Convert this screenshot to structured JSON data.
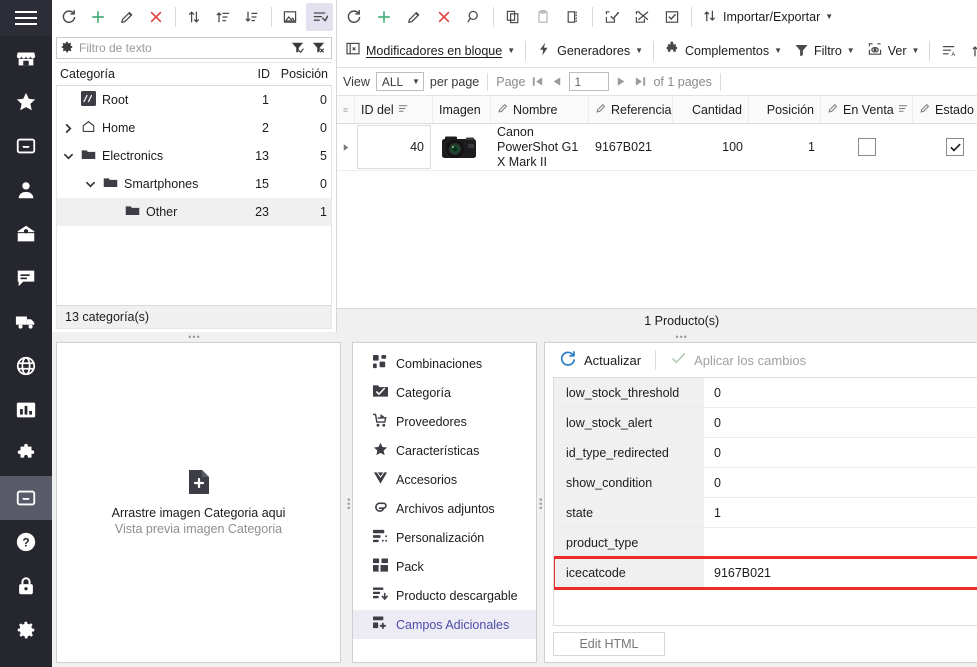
{
  "sidebar": {
    "menu_icon": "hamburger-menu-icon",
    "items": [
      {
        "icon": "store-icon",
        "name": "sidebar-item-store",
        "active": false
      },
      {
        "icon": "star-icon",
        "name": "sidebar-item-favorites",
        "active": false
      },
      {
        "icon": "inbox-icon",
        "name": "sidebar-item-orders",
        "active": false
      },
      {
        "icon": "user-icon",
        "name": "sidebar-item-customers",
        "active": false
      },
      {
        "icon": "envelope-icon",
        "name": "sidebar-item-messages",
        "active": false
      },
      {
        "icon": "chat-icon",
        "name": "sidebar-item-chat",
        "active": false
      },
      {
        "icon": "truck-icon",
        "name": "sidebar-item-shipping",
        "active": false
      },
      {
        "icon": "globe-icon",
        "name": "sidebar-item-localization",
        "active": false
      },
      {
        "icon": "chart-icon",
        "name": "sidebar-item-stats",
        "active": false
      },
      {
        "icon": "puzzle-icon",
        "name": "sidebar-item-modules",
        "active": false
      },
      {
        "icon": "inbox-icon",
        "name": "sidebar-item-catalog",
        "active": true
      },
      {
        "icon": "help-icon",
        "name": "sidebar-item-help",
        "active": false
      },
      {
        "icon": "lock-icon",
        "name": "sidebar-item-security",
        "active": false
      },
      {
        "icon": "gear-icon",
        "name": "sidebar-item-settings",
        "active": false
      }
    ]
  },
  "category_panel": {
    "toolbar": [
      {
        "icon": "refresh-icon",
        "name": "category-refresh-button",
        "selected": false
      },
      {
        "icon": "plus-icon",
        "name": "category-add-button",
        "selected": false
      },
      {
        "icon": "pencil-icon",
        "name": "category-edit-button",
        "selected": false
      },
      {
        "icon": "close-x-icon",
        "name": "category-delete-button",
        "selected": false
      },
      {
        "icon": "sort-updown-icon",
        "name": "category-sort-button",
        "selected": false
      },
      {
        "icon": "sort-asc-icon",
        "name": "category-sort-asc-button",
        "selected": false
      },
      {
        "icon": "sort-desc-icon",
        "name": "category-sort-desc-button",
        "selected": false
      },
      {
        "icon": "image-export-icon",
        "name": "category-image-button",
        "selected": false
      },
      {
        "icon": "filter-list-icon",
        "name": "category-filter-button",
        "selected": true
      }
    ],
    "filter": {
      "gear_icon": "gear-icon",
      "placeholder": "Filtro de texto",
      "value": "",
      "apply_icon": "filter-apply-icon",
      "clear_icon": "filter-clear-icon"
    },
    "columns": [
      "Categoría",
      "ID",
      "Posición"
    ],
    "rows": [
      {
        "label": "Root",
        "id": "1",
        "position": "0",
        "depth": 0,
        "twisty": "none",
        "icon": "root-icon",
        "selected": false
      },
      {
        "label": "Home",
        "id": "2",
        "position": "0",
        "depth": 0,
        "twisty": "collapsed",
        "icon": "home-icon",
        "selected": false
      },
      {
        "label": "Electronics",
        "id": "13",
        "position": "5",
        "depth": 0,
        "twisty": "expanded",
        "icon": "folder-icon",
        "selected": false
      },
      {
        "label": "Smartphones",
        "id": "15",
        "position": "0",
        "depth": 1,
        "twisty": "expanded",
        "icon": "folder-icon",
        "selected": false
      },
      {
        "label": "Other",
        "id": "23",
        "position": "1",
        "depth": 2,
        "twisty": "none",
        "icon": "folder-icon",
        "selected": true
      }
    ],
    "status": "13 categoría(s)"
  },
  "product_panel": {
    "toolbar_icons": [
      {
        "icon": "refresh-icon",
        "name": "product-refresh-button"
      },
      {
        "icon": "plus-icon",
        "name": "product-add-button"
      },
      {
        "icon": "pencil-icon",
        "name": "product-edit-button"
      },
      {
        "icon": "close-x-icon",
        "name": "product-delete-button"
      },
      {
        "icon": "search-icon",
        "name": "product-search-button"
      },
      {
        "icon": "copy-icon",
        "name": "product-copy-button"
      },
      {
        "icon": "paste-icon",
        "name": "product-paste-button"
      },
      {
        "icon": "duplicate-icon",
        "name": "product-duplicate-button"
      },
      {
        "icon": "select-all-icon",
        "name": "product-select-all-button"
      },
      {
        "icon": "deselect-icon",
        "name": "product-deselect-button"
      },
      {
        "icon": "check-select-icon",
        "name": "product-check-select-button"
      }
    ],
    "import_export": {
      "label": "Importar/Exportar",
      "icon": "import-export-icon"
    },
    "menus": [
      {
        "label": "Modificadores en bloque",
        "icon": "bulk-modifier-icon",
        "name": "menu-bulk-modifiers"
      },
      {
        "label": "Generadores",
        "icon": "lightning-icon",
        "name": "menu-generators"
      },
      {
        "label": "Complementos",
        "icon": "puzzle-icon",
        "name": "menu-addons"
      },
      {
        "label": "Filtro",
        "icon": "filter-icon",
        "name": "menu-filter"
      },
      {
        "label": "Ver",
        "icon": "eye-box-icon",
        "name": "menu-view"
      }
    ],
    "menu_trailing_icons": [
      {
        "icon": "sort-alpha-icon",
        "name": "sort-alpha-button"
      },
      {
        "icon": "sort-asc-icon",
        "name": "sort-asc-button"
      },
      {
        "icon": "sort-desc-icon",
        "name": "sort-desc-button"
      }
    ],
    "pager": {
      "view_label": "View",
      "per_page_value": "ALL",
      "per_page_label": "per page",
      "page_label": "Page",
      "page_value": "1",
      "of_pages": "of 1 pages",
      "first_icon": "first-page-icon",
      "prev_icon": "prev-page-icon",
      "next_icon": "next-page-icon",
      "last_icon": "last-page-icon"
    },
    "columns": [
      {
        "label": "ID del",
        "editable": false,
        "menu": true,
        "name": "col-id"
      },
      {
        "label": "Imagen",
        "editable": false,
        "menu": false,
        "name": "col-image"
      },
      {
        "label": "Nombre",
        "editable": true,
        "menu": false,
        "name": "col-name"
      },
      {
        "label": "Referencia",
        "editable": true,
        "menu": false,
        "name": "col-reference"
      },
      {
        "label": "Cantidad",
        "editable": false,
        "menu": false,
        "name": "col-quantity"
      },
      {
        "label": "Posición",
        "editable": false,
        "menu": false,
        "name": "col-position"
      },
      {
        "label": "En Venta",
        "editable": true,
        "menu": true,
        "name": "col-on-sale"
      },
      {
        "label": "Estado",
        "editable": true,
        "menu": false,
        "name": "col-status"
      }
    ],
    "rows": [
      {
        "id": "40",
        "image_alt": "canon-powershot-thumbnail",
        "name": "Canon PowerShot G1 X Mark II",
        "reference": "9167B021",
        "quantity": "100",
        "position": "1",
        "on_sale": false,
        "status": true
      }
    ],
    "status": "1 Producto(s)"
  },
  "image_drop": {
    "icon": "add-file-icon",
    "title": "Arrastre imagen Categoria aqui",
    "subtitle": "Vista previa imagen Categoria"
  },
  "tabs": [
    {
      "label": "Combinaciones",
      "icon": "combinations-icon",
      "selected": false
    },
    {
      "label": "Categoría",
      "icon": "category-check-icon",
      "selected": false
    },
    {
      "label": "Proveedores",
      "icon": "supplier-icon",
      "selected": false
    },
    {
      "label": "Características",
      "icon": "star-icon",
      "selected": false
    },
    {
      "label": "Accesorios",
      "icon": "diamond-icon",
      "selected": false
    },
    {
      "label": "Archivos adjuntos",
      "icon": "paperclip-icon",
      "selected": false
    },
    {
      "label": "Personalización",
      "icon": "customization-icon",
      "selected": false
    },
    {
      "label": "Pack",
      "icon": "pack-icon",
      "selected": false
    },
    {
      "label": "Producto descargable",
      "icon": "download-icon",
      "selected": false
    },
    {
      "label": "Campos Adicionales",
      "icon": "extra-fields-icon",
      "selected": true
    }
  ],
  "detail": {
    "refresh": {
      "label": "Actualizar",
      "icon": "refresh-icon"
    },
    "apply": {
      "label": "Aplicar los cambios",
      "icon": "check-icon",
      "disabled": true
    },
    "fields": [
      {
        "key": "low_stock_threshold",
        "value": "0",
        "highlighted": false
      },
      {
        "key": "low_stock_alert",
        "value": "0",
        "highlighted": false
      },
      {
        "key": "id_type_redirected",
        "value": "0",
        "highlighted": false
      },
      {
        "key": "show_condition",
        "value": "0",
        "highlighted": false
      },
      {
        "key": "state",
        "value": "1",
        "highlighted": false
      },
      {
        "key": "product_type",
        "value": "",
        "highlighted": false
      },
      {
        "key": "icecatcode",
        "value": "9167B021",
        "highlighted": true
      }
    ],
    "edit_html_label": "Edit HTML"
  },
  "colors": {
    "rail_bg": "#25262e",
    "rail_active": "#5a5b68",
    "accent_selected_tab": "#4d4ba8",
    "highlight_outline": "#ee2b2b",
    "add_green": "#4caf7d",
    "delete_red": "#e04a4a",
    "panel_bg": "#f0f0f0"
  }
}
